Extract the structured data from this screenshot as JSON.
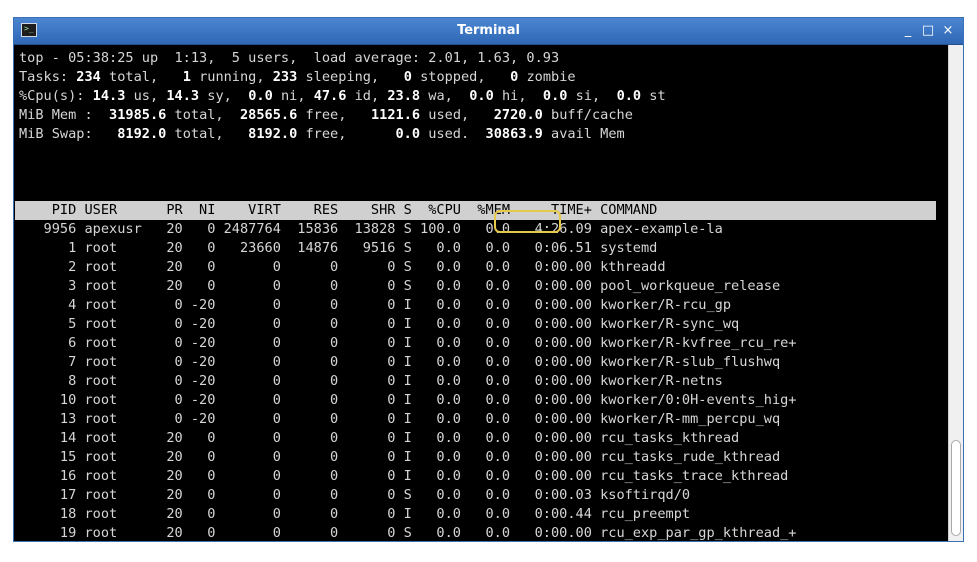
{
  "window": {
    "title": "Terminal",
    "minimize": "_",
    "maximize": "□",
    "close": "×"
  },
  "summary": {
    "uptime_line": "top - 05:38:25 up  1:13,  5 users,  load average: 2.01, 1.63, 0.93",
    "tasks": [
      "Tasks: ",
      "234",
      " total,   ",
      "1",
      " running, ",
      "233",
      " sleeping,   ",
      "0",
      " stopped,   ",
      "0",
      " zombie"
    ],
    "cpu": [
      "%Cpu(s): ",
      "14.3",
      " us, ",
      "14.3",
      " sy,  ",
      "0.0",
      " ni, ",
      "47.6",
      " id, ",
      "23.8",
      " wa,  ",
      "0.0",
      " hi,  ",
      "0.0",
      " si,  ",
      "0.0",
      " st"
    ],
    "mem": [
      "MiB Mem :  ",
      "31985.6",
      " total,  ",
      "28565.6",
      " free,   ",
      "1121.6",
      " used,   ",
      "2720.0",
      " buff/cache"
    ],
    "swap": [
      "MiB Swap:   ",
      "8192.0",
      " total,   ",
      "8192.0",
      " free,      ",
      "0.0",
      " used.  ",
      "30863.9",
      " avail Mem"
    ]
  },
  "table": {
    "header": "    PID USER      PR  NI    VIRT    RES    SHR S  %CPU  %MEM     TIME+ COMMAND",
    "rows": [
      "   9956 apexusr   20   0 2487764  15836  13828 S 100.0   0.0   4:26.09 apex-example-la",
      "      1 root      20   0   23660  14876   9516 S   0.0   0.0   0:06.51 systemd",
      "      2 root      20   0       0      0      0 S   0.0   0.0   0:00.00 kthreadd",
      "      3 root      20   0       0      0      0 S   0.0   0.0   0:00.00 pool_workqueue_release",
      "      4 root       0 -20       0      0      0 I   0.0   0.0   0:00.00 kworker/R-rcu_gp",
      "      5 root       0 -20       0      0      0 I   0.0   0.0   0:00.00 kworker/R-sync_wq",
      "      6 root       0 -20       0      0      0 I   0.0   0.0   0:00.00 kworker/R-kvfree_rcu_re+",
      "      7 root       0 -20       0      0      0 I   0.0   0.0   0:00.00 kworker/R-slub_flushwq",
      "      8 root       0 -20       0      0      0 I   0.0   0.0   0:00.00 kworker/R-netns",
      "     10 root       0 -20       0      0      0 I   0.0   0.0   0:00.00 kworker/0:0H-events_hig+",
      "     13 root       0 -20       0      0      0 I   0.0   0.0   0:00.00 kworker/R-mm_percpu_wq",
      "     14 root      20   0       0      0      0 I   0.0   0.0   0:00.00 rcu_tasks_kthread",
      "     15 root      20   0       0      0      0 I   0.0   0.0   0:00.00 rcu_tasks_rude_kthread",
      "     16 root      20   0       0      0      0 I   0.0   0.0   0:00.00 rcu_tasks_trace_kthread",
      "     17 root      20   0       0      0      0 S   0.0   0.0   0:00.03 ksoftirqd/0",
      "     18 root      20   0       0      0      0 I   0.0   0.0   0:00.44 rcu_preempt",
      "     19 root      20   0       0      0      0 S   0.0   0.0   0:00.00 rcu_exp_par_gp_kthread_+"
    ]
  },
  "colors": {
    "highlight": "#e6c84a",
    "titlebar": "#3d78c6",
    "terminal_bg": "#000000"
  }
}
